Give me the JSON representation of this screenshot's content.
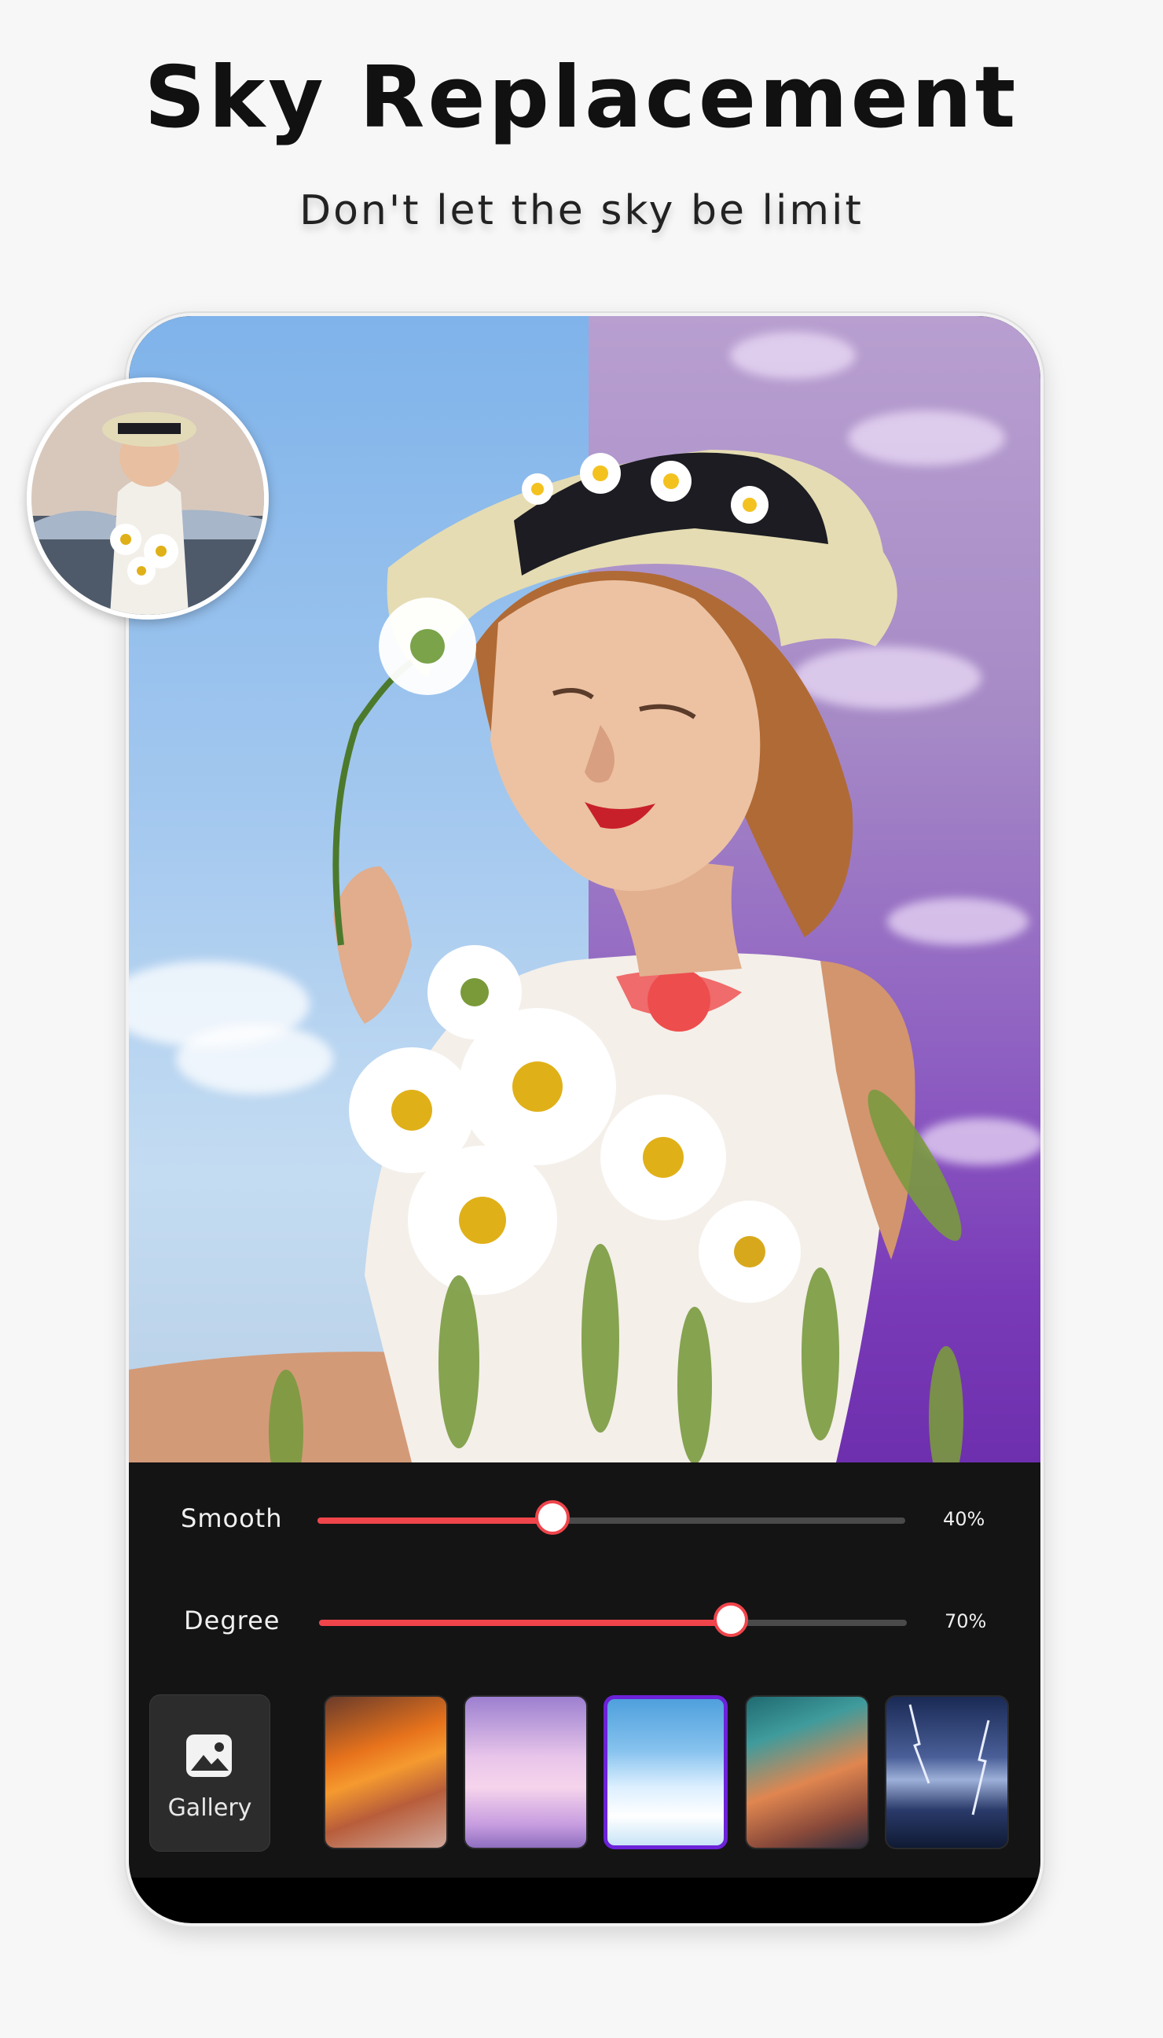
{
  "header": {
    "title": "Sky Replacement",
    "subtitle": "Don't let the sky be limit"
  },
  "editor": {
    "sliders": [
      {
        "label": "Smooth",
        "value": 40,
        "display": "40%"
      },
      {
        "label": "Degree",
        "value": 70,
        "display": "70%"
      }
    ],
    "gallery_label": "Gallery",
    "sky_presets": [
      {
        "name": "sunset-fire-clouds",
        "selected": false
      },
      {
        "name": "pink-cotton-clouds",
        "selected": false
      },
      {
        "name": "blue-sky-clouds",
        "selected": true
      },
      {
        "name": "dramatic-storm-sunset",
        "selected": false
      },
      {
        "name": "lightning-night",
        "selected": false
      }
    ]
  },
  "colors": {
    "accent": "#f0454b",
    "selected_border": "#6b22d8",
    "panel_bg": "#141414"
  }
}
